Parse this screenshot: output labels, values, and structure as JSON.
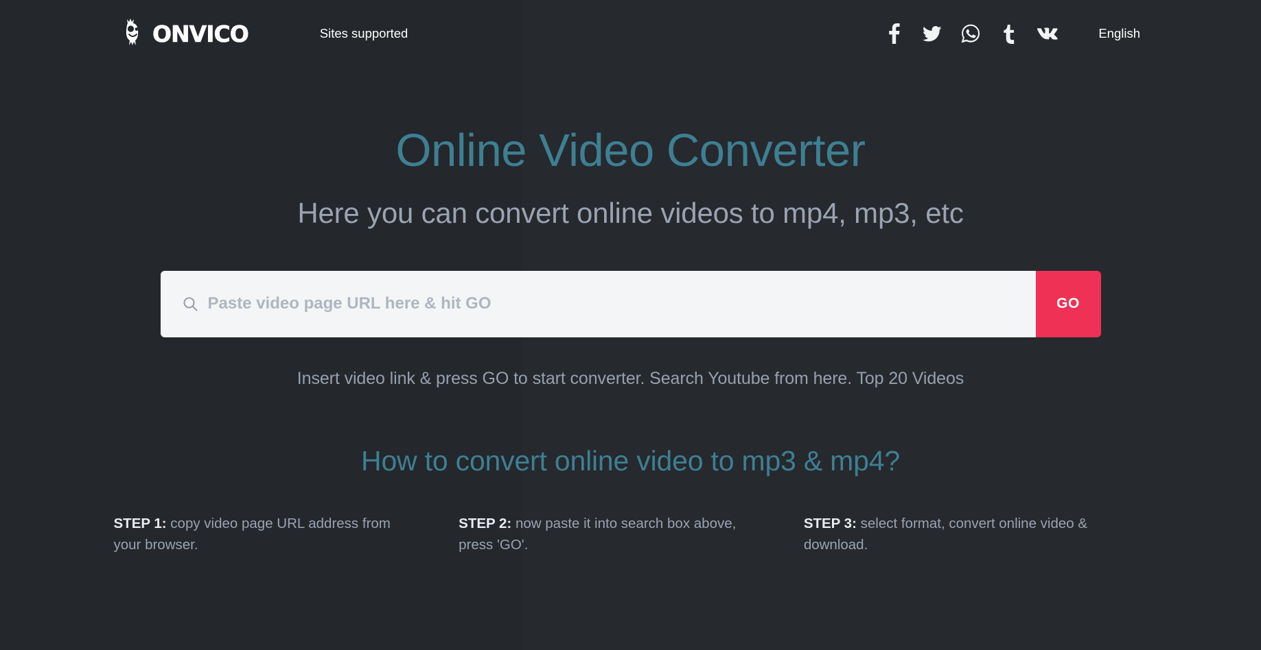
{
  "header": {
    "logo_text": "ONVICO",
    "logo_icon": "monster-mascot-icon",
    "nav": [
      {
        "label": "Sites supported",
        "name": "sites-supported"
      }
    ],
    "social": [
      {
        "name": "facebook-icon",
        "label": "Facebook"
      },
      {
        "name": "twitter-icon",
        "label": "Twitter"
      },
      {
        "name": "whatsapp-icon",
        "label": "WhatsApp"
      },
      {
        "name": "tumblr-icon",
        "label": "Tumblr"
      },
      {
        "name": "vk-icon",
        "label": "VK"
      }
    ],
    "language": "English"
  },
  "hero": {
    "title": "Online Video Converter",
    "subtitle": "Here you can convert online videos to mp4, mp3, etc"
  },
  "search": {
    "icon": "search-icon",
    "placeholder": "Paste video page URL here & hit GO",
    "value": "",
    "button_label": "GO",
    "hint": "Insert video link & press GO to start converter. Search Youtube from here. Top 20 Videos"
  },
  "howto": {
    "heading": "How to convert online video to mp3 & mp4?",
    "steps": [
      {
        "label": "STEP 1:",
        "text": " copy video page URL address from your browser."
      },
      {
        "label": "STEP 2:",
        "text": " now paste it into search box above, press 'GO'."
      },
      {
        "label": "STEP 3:",
        "text": " select format, convert online video & download."
      }
    ]
  },
  "colors": {
    "background": "#24272c",
    "accent_teal": "#3e7f92",
    "accent_red": "#ef3156",
    "body_text": "#9aa3b2",
    "input_background": "#f4f5f7"
  }
}
